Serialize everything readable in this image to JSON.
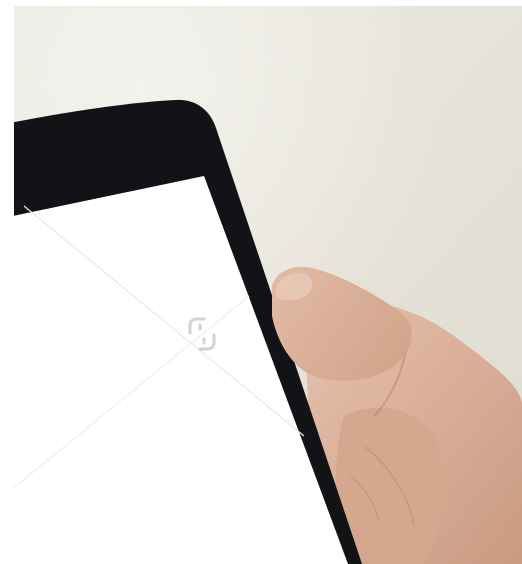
{
  "photo": {
    "subject": "hand-holding-smartphone",
    "colors": {
      "background": "#e9e6dc",
      "phone_bezel": "#121417",
      "screen": "#ffffff",
      "skin": "#dcb39d"
    },
    "watermark_icon": "watermark-icon"
  }
}
